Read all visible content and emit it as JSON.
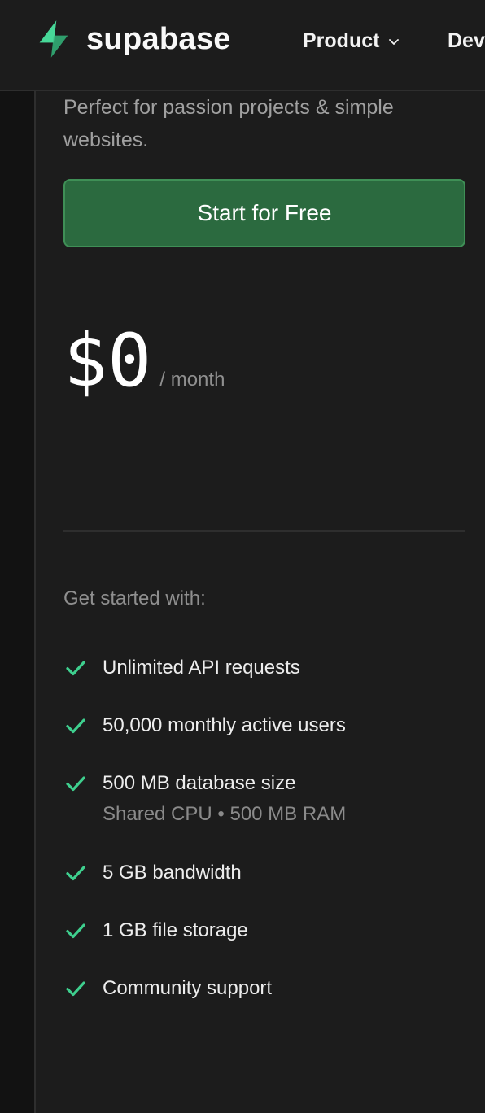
{
  "header": {
    "brand": "supabase",
    "nav": [
      {
        "label": "Product"
      },
      {
        "label": "Dev"
      }
    ]
  },
  "plan": {
    "tagline": "Perfect for passion projects & simple websites.",
    "cta_label": "Start for Free",
    "price": "$0",
    "period": "/ month",
    "features_heading": "Get started with:",
    "features": [
      {
        "label": "Unlimited API requests"
      },
      {
        "label": "50,000 monthly active users"
      },
      {
        "label": "500 MB database size",
        "detail": "Shared CPU • 500 MB RAM"
      },
      {
        "label": "5 GB bandwidth"
      },
      {
        "label": "1 GB file storage"
      },
      {
        "label": "Community support"
      }
    ]
  },
  "colors": {
    "brand_green": "#3ecf8e",
    "cta_background": "#2b6a3f",
    "background": "#1c1c1c"
  },
  "icons": [
    "supabase-logo-icon",
    "chevron-down-icon",
    "check-icon"
  ]
}
